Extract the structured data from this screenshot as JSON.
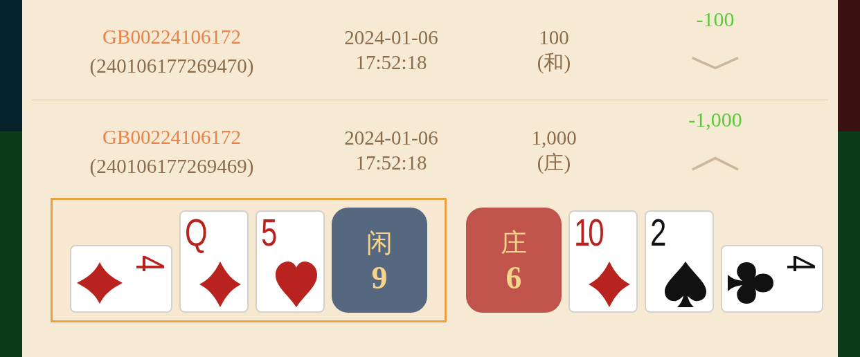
{
  "records": [
    {
      "order_no": "GB00224106172",
      "round_id": "(240106177269470)",
      "date": "2024-01-06",
      "time": "17:52:18",
      "amount": "100",
      "bet": "(和)",
      "result": "-100",
      "expanded": false
    },
    {
      "order_no": "GB00224106172",
      "round_id": "(240106177269469)",
      "date": "2024-01-06",
      "time": "17:52:18",
      "amount": "1,000",
      "bet": "(庄)",
      "result": "-1,000",
      "expanded": true,
      "hands": [
        {
          "kind": "player",
          "label": "闲",
          "total": "9",
          "highlighted": true,
          "cards": [
            {
              "rank": "4",
              "kind": "diamond",
              "sideways": true
            },
            {
              "rank": "Q",
              "kind": "diamond",
              "sideways": false
            },
            {
              "rank": "5",
              "kind": "heart",
              "sideways": false
            }
          ]
        },
        {
          "kind": "banker",
          "label": "庄",
          "total": "6",
          "highlighted": false,
          "cards": [
            {
              "rank": "10",
              "kind": "diamond",
              "sideways": false
            },
            {
              "rank": "2",
              "kind": "spade",
              "sideways": false
            },
            {
              "rank": "4",
              "kind": "club",
              "sideways": true
            }
          ]
        }
      ]
    }
  ]
}
